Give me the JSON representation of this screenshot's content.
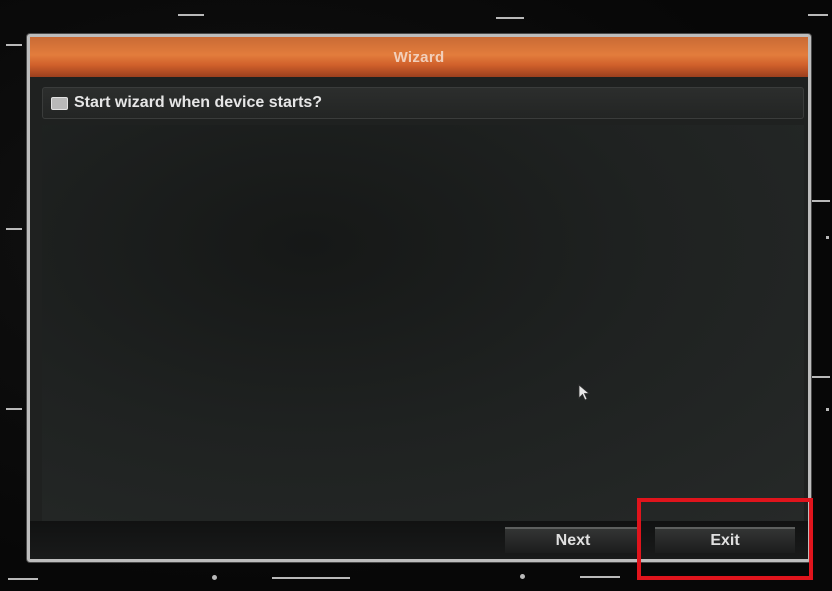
{
  "wizard": {
    "title": "Wizard",
    "option": {
      "label": "Start wizard when device starts?",
      "checked": true
    },
    "buttons": {
      "next_label": "Next",
      "exit_label": "Exit"
    }
  },
  "colors": {
    "title_bar_accent": "#e37c3c",
    "highlight_box": "#e0141c",
    "window_background": "#1f2120"
  },
  "icons": {
    "checkbox": "checkbox-icon",
    "cursor": "mouse-pointer-icon"
  }
}
